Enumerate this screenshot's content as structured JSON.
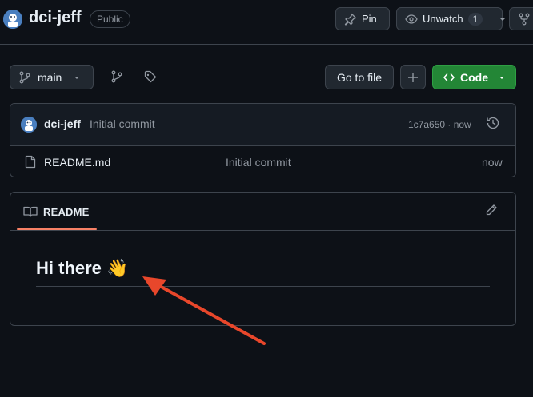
{
  "repo": {
    "name": "dci-jeff",
    "visibility": "Public"
  },
  "actions": {
    "pin_label": "Pin",
    "watch_label": "Unwatch",
    "watch_count": "1"
  },
  "toolbar": {
    "branch": "main",
    "go_to_file": "Go to file",
    "code_label": "Code"
  },
  "latest_commit": {
    "author": "dci-jeff",
    "message": "Initial commit",
    "sha_time": "1c7a650 · now"
  },
  "files": [
    {
      "name": "README.md",
      "commit_message": "Initial commit",
      "time": "now"
    }
  ],
  "readme": {
    "tab_label": "README",
    "heading": "Hi there 👋"
  },
  "colors": {
    "background": "#0d1117",
    "accent_green": "#238636",
    "tab_underline": "#f78166",
    "annotation_arrow": "#e8472b"
  }
}
